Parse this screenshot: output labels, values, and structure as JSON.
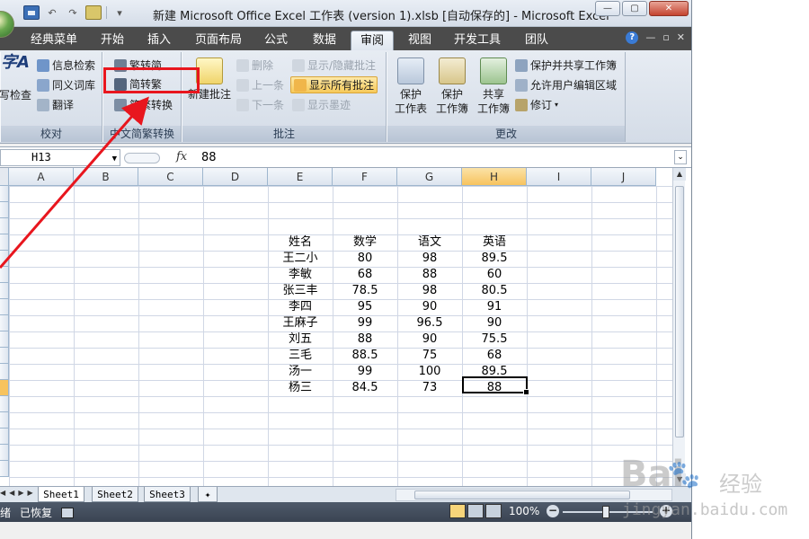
{
  "title_bar": {
    "title": "新建 Microsoft Office Excel 工作表 (version 1).xlsb [自动保存的] - Microsoft Excel",
    "minimize": "—",
    "maximize": "▢",
    "close": "✕"
  },
  "tabs": [
    "经典菜单",
    "开始",
    "插入",
    "页面布局",
    "公式",
    "数据",
    "审阅",
    "视图",
    "开发工具",
    "团队"
  ],
  "active_tab": "审阅",
  "ribbon": {
    "proofing": {
      "label": "校对",
      "spelling_big": "字A",
      "spelling_label": "写检查",
      "research": "信息检索",
      "thesaurus": "同义词库",
      "translate": "翻译"
    },
    "chinese_conversion": {
      "label": "中文简繁转换",
      "trad_to_simp": "繁转简",
      "simp_to_trad": "简转繁",
      "conversion": "简繁转换"
    },
    "comments": {
      "label": "批注",
      "new_comment": "新建批注",
      "delete": "删除",
      "previous": "上一条",
      "next": "下一条",
      "show_hide": "显示/隐藏批注",
      "show_all": "显示所有批注",
      "show_ink": "显示墨迹"
    },
    "changes": {
      "label": "更改",
      "protect_sheet": [
        "保护",
        "工作表"
      ],
      "protect_workbook": [
        "保护",
        "工作簿"
      ],
      "share_workbook": [
        "共享",
        "工作簿"
      ],
      "protect_share": "保护并共享工作簿",
      "allow_edit_ranges": "允许用户编辑区域",
      "track_changes": "修订"
    }
  },
  "formula_bar": {
    "name_box": "H13",
    "fx": "fx",
    "value": "88"
  },
  "columns": [
    "A",
    "B",
    "C",
    "D",
    "E",
    "F",
    "G",
    "H",
    "I",
    "J"
  ],
  "active_column": "H",
  "table": {
    "headers": [
      "姓名",
      "数学",
      "语文",
      "英语"
    ],
    "rows": [
      [
        "王二小",
        "80",
        "98",
        "89.5"
      ],
      [
        "李敏",
        "68",
        "88",
        "60"
      ],
      [
        "张三丰",
        "78.5",
        "98",
        "80.5"
      ],
      [
        "李四",
        "95",
        "90",
        "91"
      ],
      [
        "王麻子",
        "99",
        "96.5",
        "90"
      ],
      [
        "刘五",
        "88",
        "90",
        "75.5"
      ],
      [
        "三毛",
        "88.5",
        "75",
        "68"
      ],
      [
        "汤一",
        "99",
        "100",
        "89.5"
      ],
      [
        "杨三",
        "84.5",
        "73",
        "88"
      ]
    ]
  },
  "sheets": [
    "Sheet1",
    "Sheet2",
    "Sheet3"
  ],
  "active_sheet": "Sheet1",
  "status": {
    "ready": "绪",
    "recovered": "已恢复",
    "zoom": "100%"
  },
  "watermark": {
    "brand": "Bai",
    "cn": "经验",
    "domain": "jingyan.baidu.com"
  },
  "annotation_color": "#e8161e"
}
